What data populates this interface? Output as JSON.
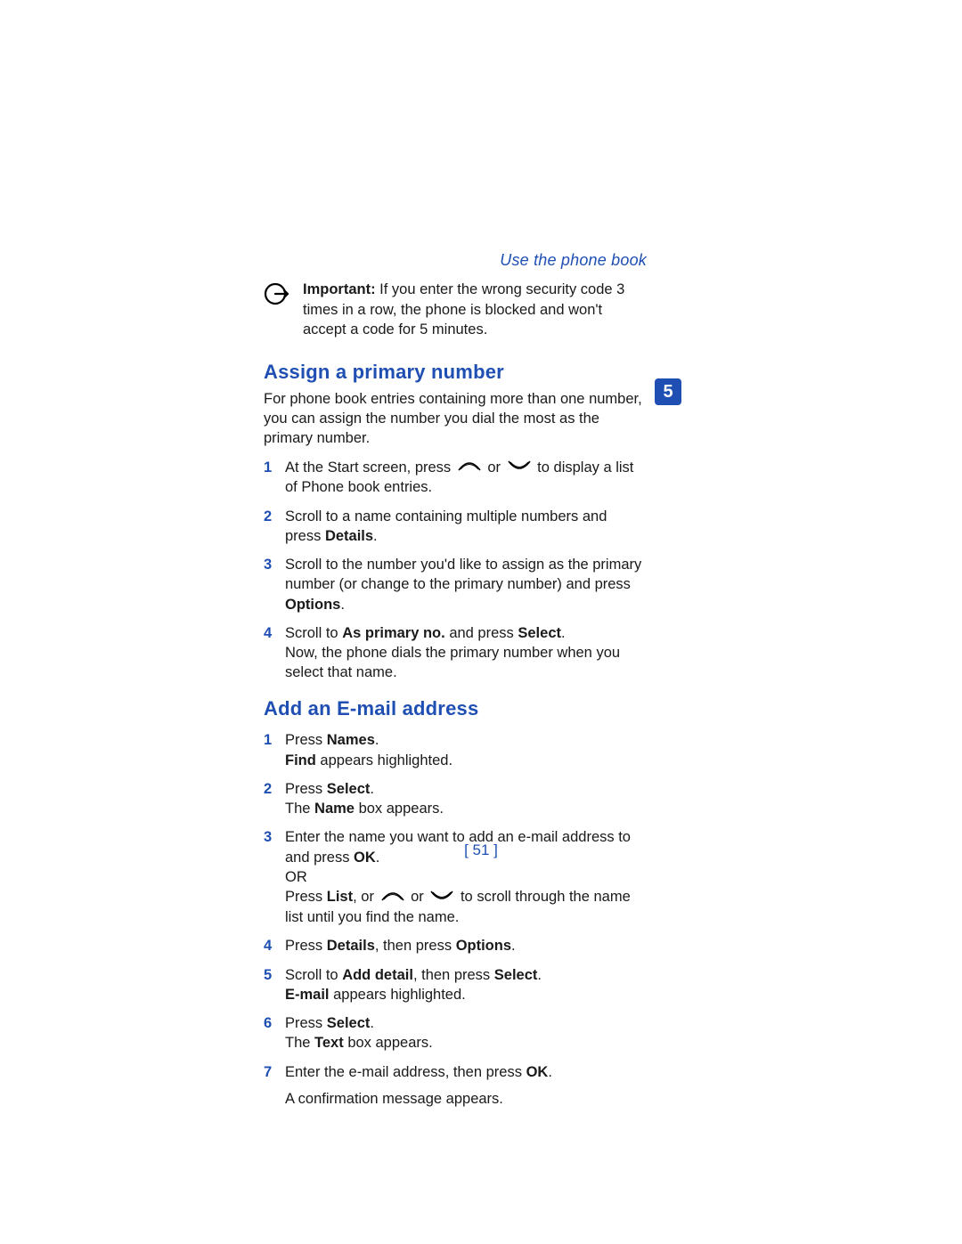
{
  "header": {
    "breadcrumb": "Use the phone book"
  },
  "chapter": {
    "number": "5"
  },
  "note": {
    "bold_label": "Important:",
    "text_after": " If you enter the wrong security code 3 times in a row, the phone is blocked and won't accept a code for 5 minutes."
  },
  "section1": {
    "title": "Assign a primary number",
    "intro": "For phone book entries containing more than one number, you can assign the number you dial the most as the primary number.",
    "steps": {
      "s1": {
        "num": "1",
        "pre": "At the Start screen, press  ",
        "mid": " or ",
        "post": "  to display a list of Phone book entries."
      },
      "s2": {
        "num": "2",
        "pre": "Scroll to a name containing multiple numbers and press ",
        "bold1": "Details",
        "post": "."
      },
      "s3": {
        "num": "3",
        "pre": "Scroll to the number you'd like to assign as the primary number (or change to the primary number) and press ",
        "bold1": "Options",
        "post": "."
      },
      "s4": {
        "num": "4",
        "pre": "Scroll to ",
        "bold1": "As primary no.",
        "mid": " and press ",
        "bold2": "Select",
        "post": ".",
        "sub": "Now, the phone dials the primary number when you select that name."
      }
    }
  },
  "section2": {
    "title": "Add an E-mail address",
    "steps": {
      "s1": {
        "num": "1",
        "pre": "Press ",
        "bold1": "Names",
        "post": ".",
        "sub_bold": "Find",
        "sub_post": " appears highlighted."
      },
      "s2": {
        "num": "2",
        "pre": "Press ",
        "bold1": "Select",
        "post": ".",
        "sub_pre": "The ",
        "sub_bold": "Name",
        "sub_post": " box appears."
      },
      "s3": {
        "num": "3",
        "pre": "Enter the name you want to add an e-mail address to and press ",
        "bold1": "OK",
        "post": ".",
        "line2": "OR",
        "line3_pre": "Press ",
        "line3_b1": "List",
        "line3_mid1": ", or  ",
        "line3_mid2": " or ",
        "line3_post": "  to scroll through the name list until you find the name."
      },
      "s4": {
        "num": "4",
        "pre": "Press ",
        "bold1": "Details",
        "mid": ", then press ",
        "bold2": "Options",
        "post": "."
      },
      "s5": {
        "num": "5",
        "pre": "Scroll to ",
        "bold1": "Add detail",
        "mid": ", then press ",
        "bold2": "Select",
        "post": ".",
        "sub_bold": "E-mail",
        "sub_post": " appears highlighted."
      },
      "s6": {
        "num": "6",
        "pre": "Press ",
        "bold1": "Select",
        "post": ".",
        "sub_pre": "The ",
        "sub_bold": "Text",
        "sub_post": " box appears."
      },
      "s7": {
        "num": "7",
        "pre": "Enter the e-mail address, then press ",
        "bold1": "OK",
        "post": ".",
        "sub": "A confirmation message appears."
      }
    }
  },
  "footer": {
    "page_number": "51"
  }
}
